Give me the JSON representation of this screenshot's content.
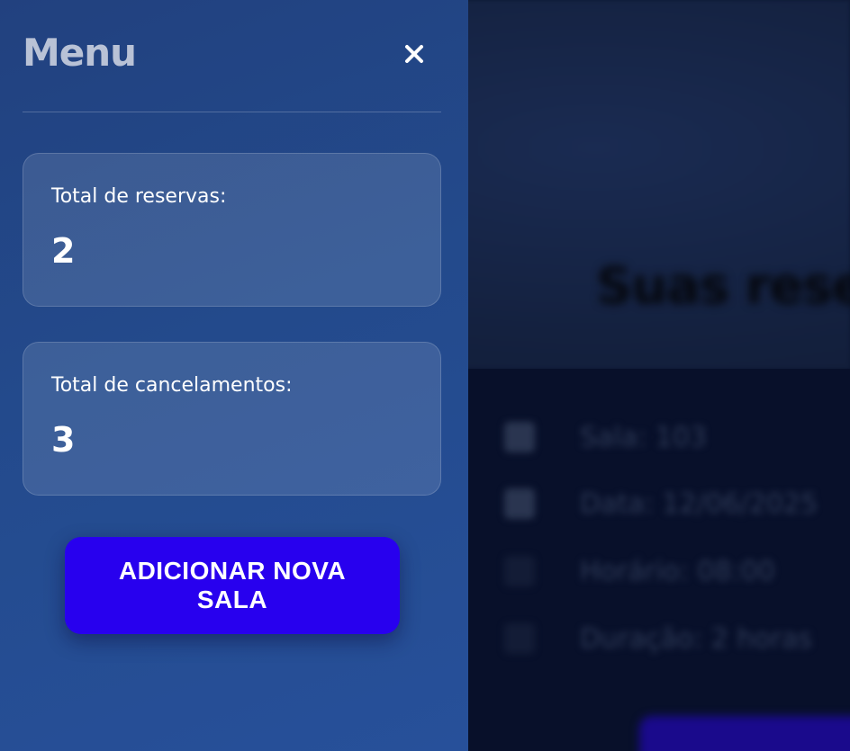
{
  "background": {
    "page_title": "Suas rese",
    "details": [
      {
        "icon": "room-icon",
        "text": "Sala: 103"
      },
      {
        "icon": "calendar-icon",
        "text": "Data: 12/06/2025"
      },
      {
        "icon": "clock-icon",
        "text": "Horário: 08:00"
      },
      {
        "icon": "hourglass-icon",
        "text": "Duração: 2 horas"
      }
    ]
  },
  "menu": {
    "title": "Menu",
    "close_icon": "close-icon",
    "stats": [
      {
        "label": "Total de reservas:",
        "value": "2"
      },
      {
        "label": "Total de cancelamentos:",
        "value": "3"
      }
    ],
    "add_room_label": "ADICIONAR NOVA SALA"
  },
  "colors": {
    "panel": "#234a8c",
    "button": "#2800ee",
    "title": "#b9c2d6"
  }
}
